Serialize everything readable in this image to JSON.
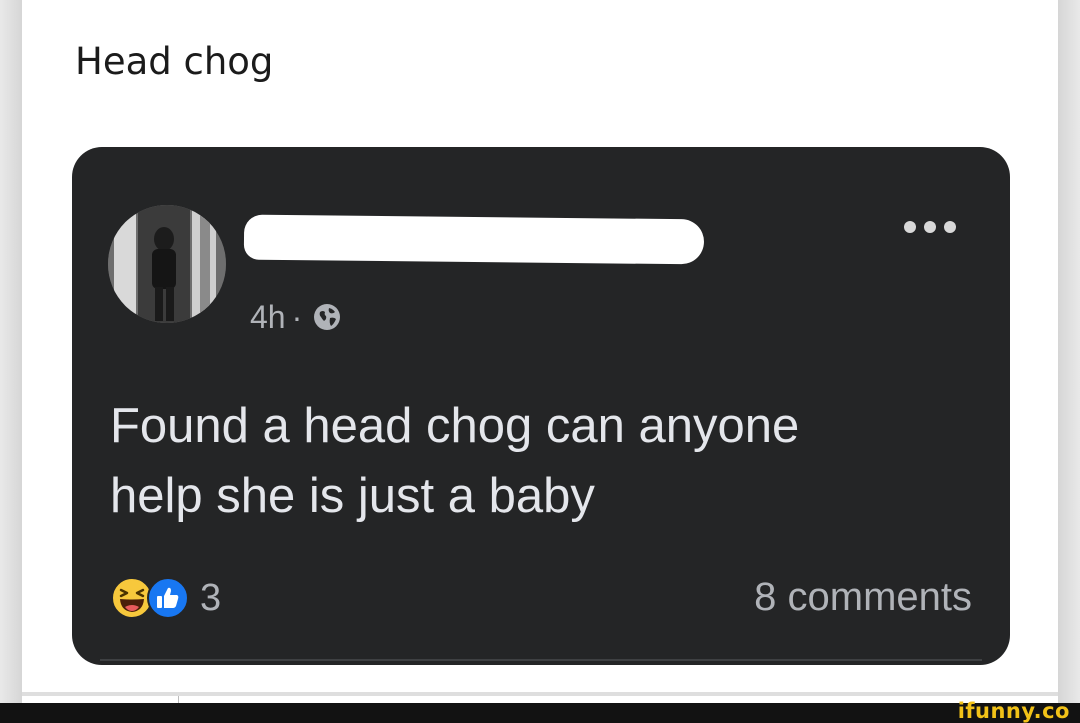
{
  "page_title": "Head chog",
  "post": {
    "time": "4h",
    "separator": "·",
    "visibility_icon": "globe-icon",
    "text": "Found a head chog can anyone\nhelp she is just a baby",
    "reactions": {
      "icons": [
        "haha-icon",
        "like-icon"
      ],
      "count": "3"
    },
    "comments_label": "8 comments"
  },
  "watermark": "ifunny.co",
  "colors": {
    "card_background": "#242526",
    "card_text": "#e4e6eb",
    "secondary_text": "#b0b3b8",
    "like_blue": "#1877f2",
    "haha_yellow": "#f7c83c",
    "watermark_yellow": "#f2c218"
  }
}
